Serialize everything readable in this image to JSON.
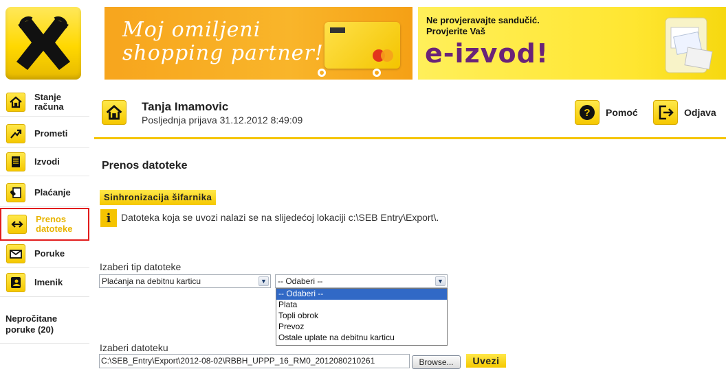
{
  "banners": {
    "left": {
      "line1": "Moj omiljeni",
      "line2": "shopping partner!"
    },
    "right": {
      "line1": "Ne provjeravajte sandučić.",
      "line2": "Provjerite Vaš",
      "line3": "e-izvod!"
    }
  },
  "sidebar": {
    "items": [
      {
        "label": "Stanje računa",
        "icon": "home-icon"
      },
      {
        "label": "Prometi",
        "icon": "trend-arrow-icon"
      },
      {
        "label": "Izvodi",
        "icon": "document-icon"
      },
      {
        "label": "Plaćanje",
        "icon": "payment-icon"
      },
      {
        "label": "Prenos datoteke",
        "icon": "transfer-arrows-icon",
        "active": true
      },
      {
        "label": "Poruke",
        "icon": "envelope-icon"
      },
      {
        "label": "Imenik",
        "icon": "address-book-icon"
      }
    ],
    "unread": "Nepročitane poruke (20)"
  },
  "header": {
    "user_name": "Tanja Imamovic",
    "last_login": "Posljednja prijava 31.12.2012 8:49:09",
    "help_label": "Pomoć",
    "logout_label": "Odjava"
  },
  "main": {
    "title": "Prenos datoteke",
    "sync_button": "Sinhronizacija šifarnika",
    "info_text": "Datoteka koja se uvozi nalazi se na slijedećoj lokaciji c:\\SEB Entry\\Export\\.",
    "type_label": "Izaberi tip datoteke",
    "type_value": "Plaćanja na debitnu karticu",
    "sub_value": "-- Odaberi --",
    "sub_options": [
      "-- Odaberi --",
      "Plata",
      "Topli obrok",
      "Prevoz",
      "Ostale uplate na debitnu karticu"
    ],
    "file_label": "Izaberi datoteku",
    "file_value": "C:\\SEB_Entry\\Export\\2012-08-02\\RBBH_UPPP_16_RM0_2012080210261",
    "browse_label": "Browse...",
    "import_label": "Uvezi"
  },
  "colors": {
    "accent": "#f5c400",
    "active_border": "#e21b1b",
    "selection": "#3169c6"
  }
}
